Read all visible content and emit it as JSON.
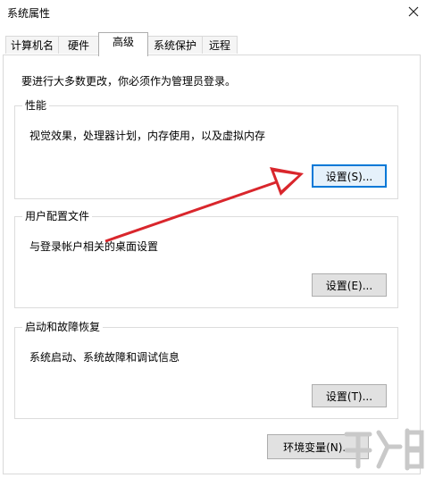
{
  "window": {
    "title": "系统属性"
  },
  "tabs": [
    {
      "label": "计算机名"
    },
    {
      "label": "硬件"
    },
    {
      "label": "高级"
    },
    {
      "label": "系统保护"
    },
    {
      "label": "远程"
    }
  ],
  "admin_note": "要进行大多数更改，你必须作为管理员登录。",
  "performance": {
    "title": "性能",
    "description": "视觉效果，处理器计划，内存使用，以及虚拟内存",
    "button_label": "设置(S)..."
  },
  "user_profiles": {
    "title": "用户配置文件",
    "description": "与登录帐户相关的桌面设置",
    "button_label": "设置(E)..."
  },
  "startup_recovery": {
    "title": "启动和故障恢复",
    "description": "系统启动、系统故障和调试信息",
    "button_label": "设置(T)..."
  },
  "env_button_label": "环境变量(N)...",
  "annotation_color": "#d9262c",
  "accent_color": "#0078d7"
}
